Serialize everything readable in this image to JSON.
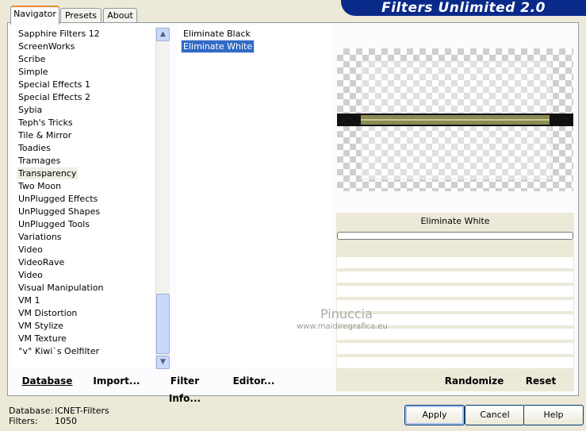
{
  "window": {
    "title": "Filters Unlimited 2.0"
  },
  "tabs": [
    {
      "label": "Navigator",
      "active": true
    },
    {
      "label": "Presets",
      "active": false
    },
    {
      "label": "About",
      "active": false
    }
  ],
  "categories": {
    "items": [
      "Sapphire Filters 12",
      "ScreenWorks",
      "Scribe",
      "Simple",
      "Special Effects 1",
      "Special Effects 2",
      "Sybia",
      "Teph's Tricks",
      "Tile & Mirror",
      "Toadies",
      "Tramages",
      "Transparency",
      "Two Moon",
      "UnPlugged Effects",
      "UnPlugged Shapes",
      "UnPlugged Tools",
      "Variations",
      "Video",
      "VideoRave",
      "Video",
      "Visual Manipulation",
      "VM 1",
      "VM Distortion",
      "VM Stylize",
      "VM Texture",
      "°v° Kiwi`s Oelfilter"
    ],
    "selected": "Transparency"
  },
  "filters": {
    "items": [
      "Eliminate Black",
      "Eliminate White"
    ],
    "selected": "Eliminate White"
  },
  "parameters": {
    "title": "Eliminate White"
  },
  "buttons": {
    "database": "Database",
    "import": "Import...",
    "filter_info": "Filter Info...",
    "editor": "Editor...",
    "randomize": "Randomize",
    "reset": "Reset",
    "apply": "Apply",
    "cancel": "Cancel",
    "help": "Help"
  },
  "status": {
    "database_label": "Database:",
    "database_value": "ICNET-Filters",
    "filters_label": "Filters:",
    "filters_value": "1050"
  },
  "watermark": {
    "name": "Pinuccia",
    "url": "www.maidiregrafica.eu"
  },
  "colors": {
    "title_bar": "#0a2a8a",
    "selection": "#316ac5",
    "dialog_bg": "#ece9d8"
  }
}
